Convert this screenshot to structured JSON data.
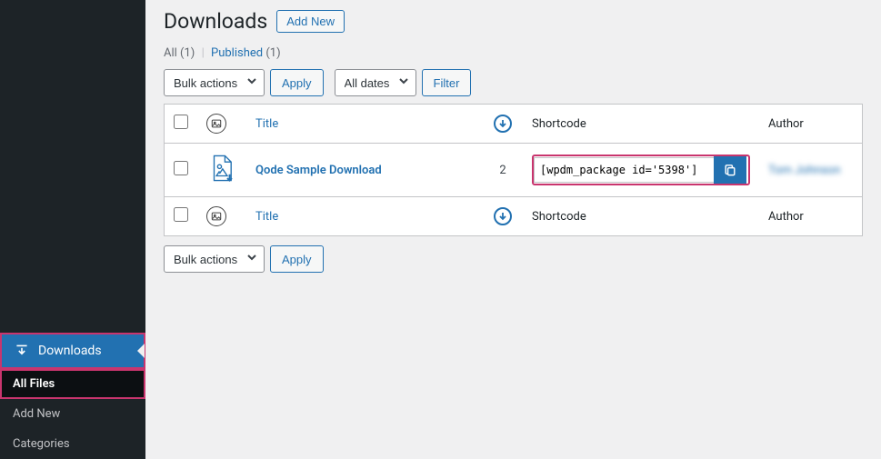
{
  "sidebar": {
    "parent": {
      "label": "Downloads"
    },
    "items": [
      {
        "label": "All Files"
      },
      {
        "label": "Add New"
      },
      {
        "label": "Categories"
      }
    ]
  },
  "header": {
    "title": "Downloads",
    "add_new": "Add New"
  },
  "views": {
    "all_label": "All",
    "all_count": "(1)",
    "published_label": "Published",
    "published_count": "(1)"
  },
  "tablenav": {
    "bulk_default": "Bulk actions",
    "apply": "Apply",
    "dates_default": "All dates",
    "filter": "Filter"
  },
  "columns": {
    "title": "Title",
    "shortcode": "Shortcode",
    "author": "Author"
  },
  "rows": [
    {
      "title": "Qode Sample Download",
      "downloads": "2",
      "shortcode": "[wpdm_package id='5398']",
      "author": "Tom Johnson"
    }
  ]
}
